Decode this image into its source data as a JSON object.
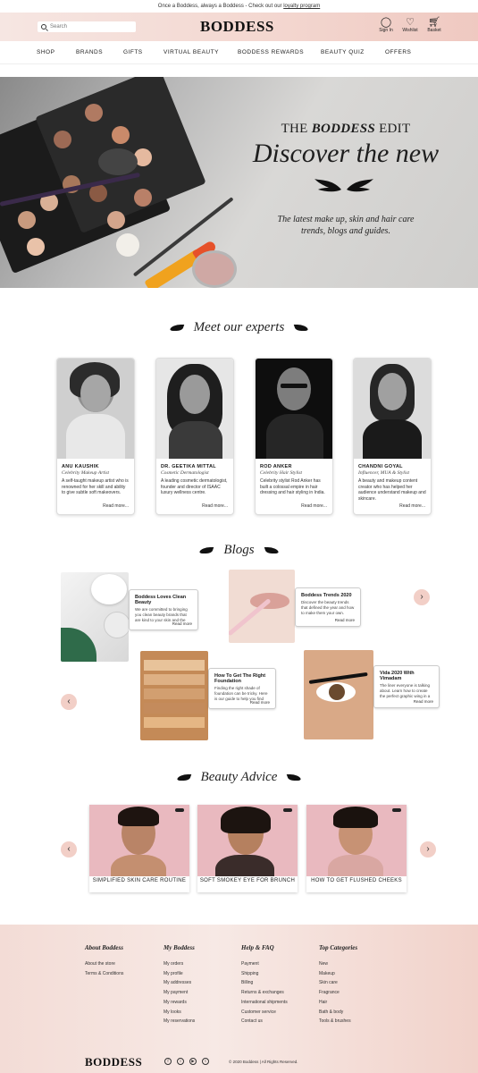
{
  "announcement": {
    "text": "Once a Boddess, always a Boddess - Check out our",
    "link": "loyalty program"
  },
  "header": {
    "brand": "BODDESS",
    "search_placeholder": "Search",
    "icons": [
      {
        "icon": "user-icon",
        "label": "Sign In"
      },
      {
        "icon": "heart-icon",
        "label": "Wishlist"
      },
      {
        "icon": "basket-icon",
        "label": "Basket"
      }
    ]
  },
  "nav": {
    "items": [
      "SHOP",
      "BRANDS",
      "GIFTS",
      "VIRTUAL BEAUTY",
      "BODDESS REWARDS",
      "BEAUTY QUIZ",
      "OFFERS"
    ]
  },
  "hero": {
    "kicker_prefix": "THE",
    "kicker_em": "BODDESS",
    "kicker_suffix": "EDIT",
    "headline": "Discover the new",
    "subtitle": "The latest make up, skin and hair care trends, blogs and guides."
  },
  "experts": {
    "title": "Meet our experts",
    "items": [
      {
        "name": "ANU KAUSHIK",
        "role": "Celebrity Makeup Artist",
        "bio": "A self-taught makeup artist who is renowned for her skill and ability to give subtle soft makeovers.",
        "more": "Read more..."
      },
      {
        "name": "DR. GEETIKA MITTAL",
        "role": "Cosmetic Dermatologist",
        "bio": "A leading cosmetic dermatologist, founder and director of ISAAC luxury wellness centre.",
        "more": "Read more..."
      },
      {
        "name": "ROD ANKER",
        "role": "Celebrity Hair Stylist",
        "bio": "Celebrity stylist Rod Anker has built a colossal empire in hair dressing and hair styling in India.",
        "more": "Read more..."
      },
      {
        "name": "CHANDNI GOYAL",
        "role": "Influencer, MUA & Stylist",
        "bio": "A beauty and makeup content creator who has helped her audience understand makeup and skincare.",
        "more": "Read more..."
      }
    ]
  },
  "blogs": {
    "title": "Blogs",
    "items": [
      {
        "title": "Boddess Loves Clean Beauty",
        "desc": "We are committed to bringing you clean beauty brands that are kind to your skin and the planet.",
        "more": "Read more"
      },
      {
        "title": "Boddess Trends 2020",
        "desc": "Discover the beauty trends that defined the year and how to make them your own.",
        "more": "Read more"
      },
      {
        "title": "How To Get The Right Foundation",
        "desc": "Finding the right shade of foundation can be tricky. Here is our guide to help you find your perfect match.",
        "more": "Read more"
      },
      {
        "title": "Vida 2020 With Vimadam",
        "desc": "The liner everyone is talking about. Learn how to create the perfect graphic wing in a few easy steps.",
        "more": "Read more"
      }
    ]
  },
  "advice": {
    "title": "Beauty Advice",
    "items": [
      {
        "caption": "SIMPLIFIED SKIN CARE ROUTINE"
      },
      {
        "caption": "SOFT SMOKEY EYE FOR BRUNCH"
      },
      {
        "caption": "HOW TO GET FLUSHED CHEEKS"
      }
    ]
  },
  "footer": {
    "columns": [
      {
        "heading": "About Boddess",
        "links": [
          "About the store",
          "Terms & Conditions"
        ]
      },
      {
        "heading": "My Boddess",
        "links": [
          "My orders",
          "My profile",
          "My addresses",
          "My payment",
          "My rewards",
          "My looks",
          "My reservations"
        ]
      },
      {
        "heading": "Help & FAQ",
        "links": [
          "Payment",
          "Shipping",
          "Billing",
          "Returns & exchanges",
          "International shipments",
          "Customer service",
          "Contact us"
        ]
      },
      {
        "heading": "Top Categories",
        "links": [
          "New",
          "Makeup",
          "Skin care",
          "Fragrance",
          "Hair",
          "Bath & body",
          "Tools & brushes"
        ]
      }
    ],
    "brand": "BODDESS",
    "copyright": "© 2020 Boddess | All Rights Reserved."
  },
  "colors": {
    "accent_pink": "#f2cfc7",
    "header_pink": "#f3d6cf"
  }
}
